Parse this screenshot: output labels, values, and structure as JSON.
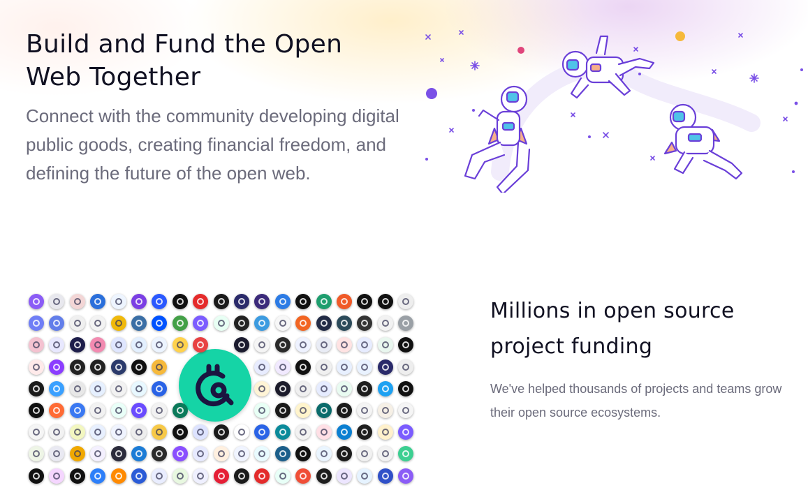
{
  "hero": {
    "title": "Build and Fund the Open Web Together",
    "subtitle": "Connect with the community developing digital public goods, creating financial freedom, and defining the future of the open web."
  },
  "illustration": {
    "icon": "astronauts-floating-illustration",
    "accent_color": "#7a50e6"
  },
  "logo_grid": {
    "icon": "project-logo-grid",
    "center_logo": "gitcoin-logo-icon",
    "center_color": "#15d4a6",
    "logo_colors": [
      "#8b5cf6",
      "#e8e8ee",
      "#f3d6d6",
      "#2a6fdb",
      "#eef5ff",
      "#7b3fe4",
      "#2b59ff",
      "#111111",
      "#e52b2b",
      "#1a1a1a",
      "#2a2a6a",
      "#3b2a7a",
      "#2c7be5",
      "#111111",
      "#1e9e6e",
      "#f05a28",
      "#111111",
      "#111111",
      "#eeeeee",
      "#6f7ef6",
      "#627eea",
      "#f0f0f0",
      "#f3f3f3",
      "#f0b90b",
      "#3a6ea5",
      "#0052ff",
      "#43a047",
      "#7c5cff",
      "#e8fff4",
      "#222222",
      "#3c9be0",
      "#f7f7f7",
      "#f26522",
      "#222b45",
      "#2b4a5a",
      "#333333",
      "#f2f2f2",
      "#9aa0a6",
      "#f4c2d0",
      "#e8e8ff",
      "#1d1d4a",
      "#f28ab0",
      "#dfe6ff",
      "#e3f0ff",
      "#ecf4ff",
      "#ffd24d",
      "#e84142",
      "#1b1b2f",
      "#f5f5f5",
      "#2a2a2a",
      "#eef2ff",
      "#e9ecf5",
      "#ffe3e3",
      "#e7ecff",
      "#e9f7ef",
      "#111111",
      "#ffeaea",
      "#8b3dff",
      "#222222",
      "#222222",
      "#2b3a6b",
      "#111111",
      "#f6b93b",
      "#e8ecff",
      "#f1e9ff",
      "#111111",
      "#f0f0f0",
      "#e8f0ff",
      "#e9f2ff",
      "#2a2a6a",
      "#eeeeee",
      "#1a1a1a",
      "#3aa0ff",
      "#e8e8e8",
      "#e6f0ff",
      "#f2f2f2",
      "#e8f8ff",
      "#2a63e6",
      "#fff4d6",
      "#1b1b2b",
      "#f0f0f0",
      "#e6ecff",
      "#e9fbf1",
      "#1d1d1d",
      "#1da1f2",
      "#111111",
      "#111111",
      "#ff6b35",
      "#3a78f2",
      "#f2f2f2",
      "#e9fff8",
      "#6a4bff",
      "#f2f2f2",
      "#0b7a5a",
      "#e8fff5",
      "#1a1a1a",
      "#fff4cc",
      "#0a6b6b",
      "#1b1b1b",
      "#f4f4f4",
      "#f6f0e6",
      "#f5f5f5",
      "#f5f5f5",
      "#f2f2f2",
      "#f3f7c0",
      "#e8f0ff",
      "#f0f4ff",
      "#eeeeee",
      "#f7c948",
      "#111111",
      "#dde3ff",
      "#1a1a1a",
      "#ffffff",
      "#2a63e6",
      "#0a8a9a",
      "#f2f2f2",
      "#ffe0e6",
      "#0b7fd1",
      "#1e1e1e",
      "#fff1cc",
      "#7b5cff",
      "#eef5e6",
      "#e9e9f2",
      "#f0a800",
      "#f4f0ff",
      "#2b2b3b",
      "#1c7cd6",
      "#2a2a2a",
      "#8a4fff",
      "#e7eaff",
      "#fff0e0",
      "#f0f4ff",
      "#e9fbff",
      "#1b5e8a",
      "#111111",
      "#eaf5ff",
      "#1b1b1b",
      "#f1f1f1",
      "#f2f2f2",
      "#3ccf91",
      "#111111",
      "#f5d6ff",
      "#111111",
      "#2d7ff9",
      "#ff8a00",
      "#2a5bd7",
      "#e9edff",
      "#e8f8e0",
      "#eff0ff",
      "#e51f36",
      "#1b1b1b",
      "#e32b2b",
      "#e8fff7",
      "#f04e37",
      "#1e1e1e",
      "#ede6ff",
      "#e6f3ff",
      "#3050c8"
    ]
  },
  "funding": {
    "heading": "Millions in open source project funding",
    "text": "We've helped thousands of projects and teams grow their open source ecosystems."
  }
}
